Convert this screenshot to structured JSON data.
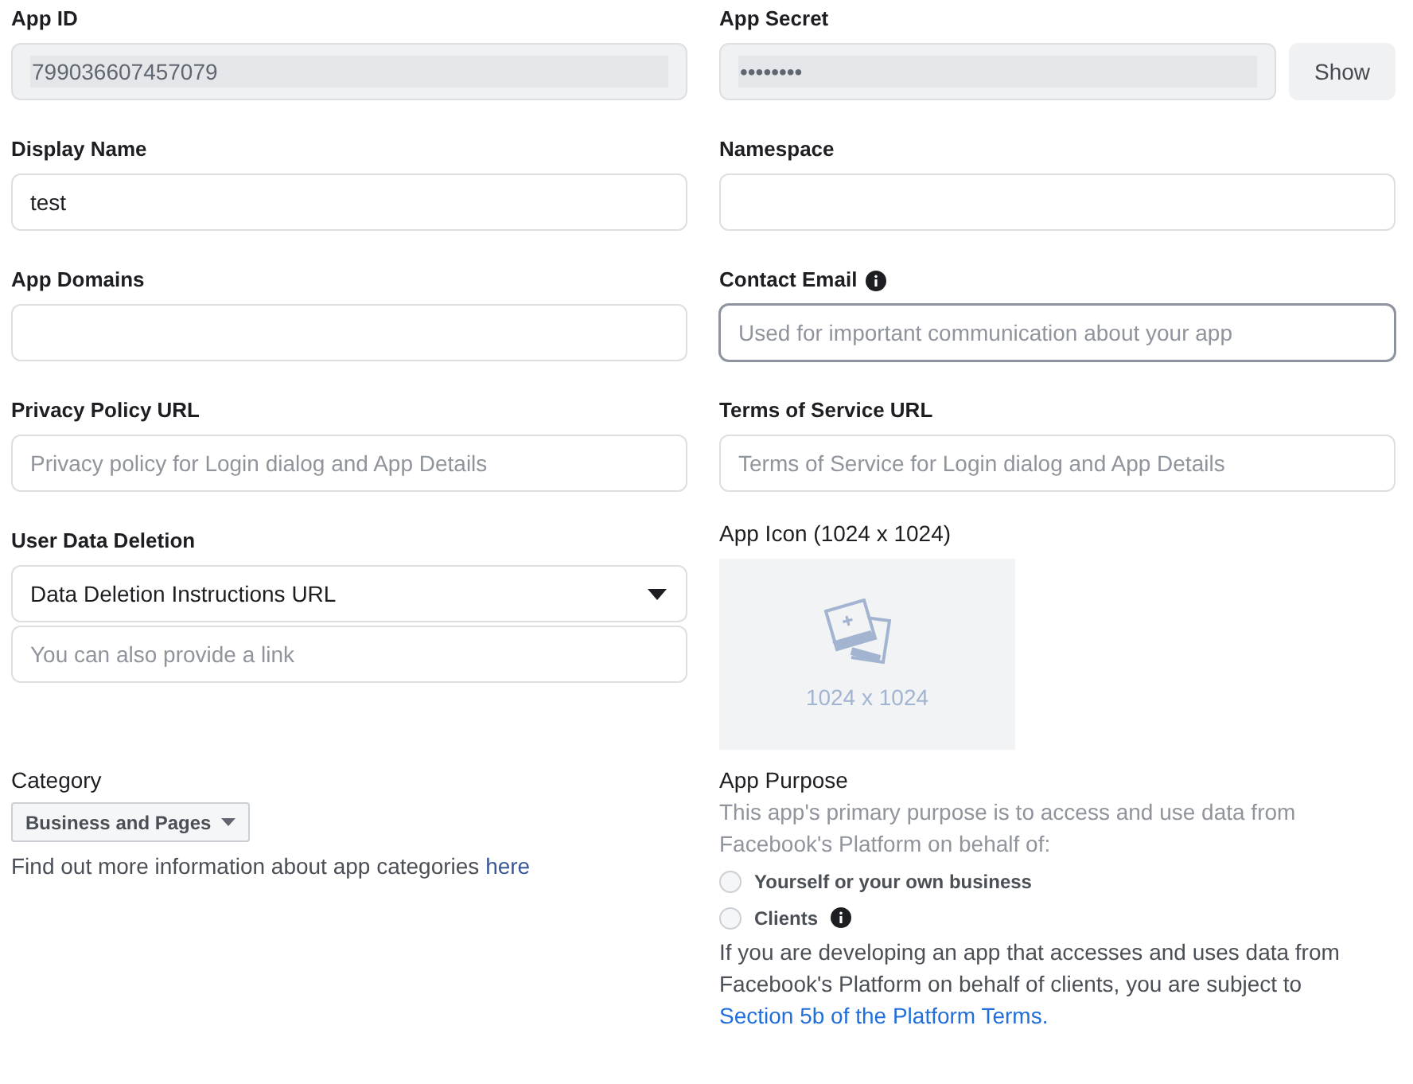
{
  "fields": [
    {
      "label": "App ID",
      "kind": "readonly",
      "value": "799036607457079"
    },
    {
      "label": "App Secret",
      "kind": "secret",
      "value": "••••••••",
      "button": "Show"
    },
    {
      "label": "Display Name",
      "kind": "text",
      "value": "test"
    },
    {
      "label": "Namespace",
      "kind": "text"
    },
    {
      "label": "App Domains",
      "kind": "text"
    },
    {
      "label": "Contact Email",
      "kind": "text",
      "info": true,
      "focused": true,
      "placeholder": "Used for important communication about your app"
    },
    {
      "label": "Privacy Policy URL",
      "kind": "text",
      "placeholder": "Privacy policy for Login dialog and App Details"
    },
    {
      "label": "Terms of Service URL",
      "kind": "text",
      "placeholder": "Terms of Service for Login dialog and App Details"
    }
  ],
  "user_data_deletion": {
    "label": "User Data Deletion",
    "select": "Data Deletion Instructions URL",
    "placeholder": "You can also provide a link"
  },
  "app_icon": {
    "label": "App Icon (1024 x 1024)",
    "size": "1024 x 1024"
  },
  "category": {
    "label": "Category",
    "value": "Business and Pages",
    "help": "Find out more information about app categories",
    "link": "here"
  },
  "app_purpose": {
    "label": "App Purpose",
    "description": "This app's primary purpose is to access and use data from Facebook's Platform on behalf of:",
    "options": [
      {
        "label": "Yourself or your own business",
        "selected": false,
        "info": false
      },
      {
        "label": "Clients",
        "selected": false,
        "info": true
      }
    ],
    "note": "If you are developing an app that accesses and uses data from Facebook's Platform on behalf of clients, you are subject to",
    "link": "Section 5b of the Platform Terms."
  }
}
